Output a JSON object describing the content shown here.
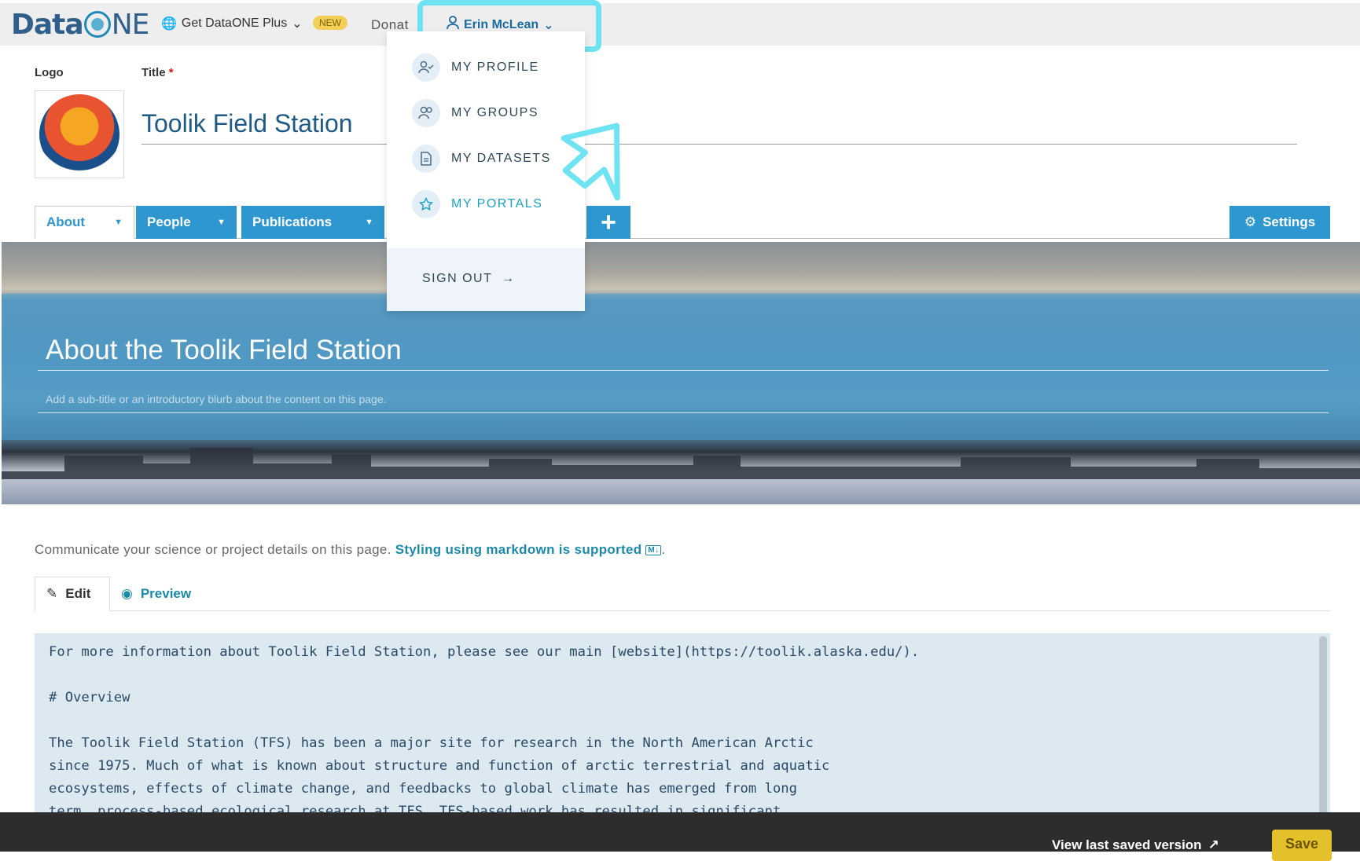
{
  "nav": {
    "brand_left": "Data",
    "brand_right": "NE",
    "get_plus": "Get DataONE Plus",
    "new_badge": "NEW",
    "donate": "Donat",
    "user_name": "Erin McLean"
  },
  "user_dropdown": {
    "items": [
      {
        "label": "MY PROFILE",
        "icon": "user-check-icon"
      },
      {
        "label": "MY GROUPS",
        "icon": "users-icon"
      },
      {
        "label": "MY DATASETS",
        "icon": "document-icon"
      },
      {
        "label": "MY PORTALS",
        "icon": "star-icon"
      }
    ],
    "sign_out": "SIGN OUT"
  },
  "editor": {
    "logo_label": "Logo",
    "title_label": "Title",
    "required_mark": "*",
    "title_value": "Toolik Field Station"
  },
  "tabs": [
    {
      "label": "About"
    },
    {
      "label": "People"
    },
    {
      "label": "Publications"
    }
  ],
  "settings_label": "Settings",
  "banner": {
    "title": "About the Toolik Field Station",
    "subtitle_placeholder": "Add a sub-title or an introductory blurb about the content on this page."
  },
  "markdown": {
    "hint_text": "Communicate your science or project details on this page.",
    "hint_link": "Styling using markdown is supported",
    "md_badge": "M↓",
    "edit_tab": "Edit",
    "preview_tab": "Preview",
    "content": "For more information about Toolik Field Station, please see our main [website](https://toolik.alaska.edu/).\n\n# Overview\n\nThe Toolik Field Station (TFS) has been a major site for research in the North American Arctic\nsince 1975. Much of what is known about structure and function of arctic terrestrial and aquatic\necosystems, effects of climate change, and feedbacks to global climate has emerged from long\nterm, process-based ecological research at TFS. TFS-based work has resulted in significant"
  },
  "footer": {
    "view_last": "View last saved version",
    "save": "Save"
  },
  "colors": {
    "accent": "#2e97cf",
    "highlight": "#6fe3f2",
    "save": "#e4c12b"
  }
}
